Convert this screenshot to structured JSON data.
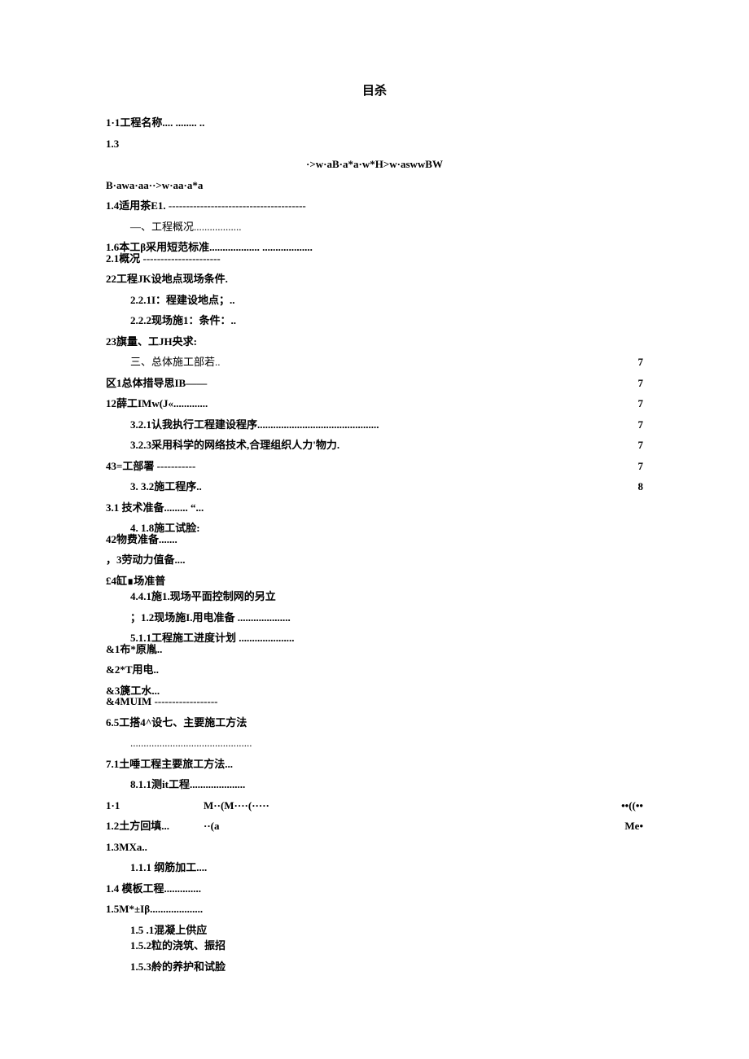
{
  "title": "目杀",
  "lines": [
    {
      "cls": "toc-line bold",
      "label": "1·1工程名称.... ........ ..",
      "page": ""
    },
    {
      "cls": "toc-line bold",
      "label": "1.3",
      "page": ""
    },
    {
      "cls": "garble center-garble",
      "label": "·>w·aB·a*a·w*H>w·aswwBW"
    },
    {
      "cls": "garble",
      "label": "B·awa·aa··>w·aa·a*a"
    },
    {
      "cls": "toc-line bold",
      "label": "1.4适用茶E1. ---------------------------------------",
      "page": ""
    },
    {
      "cls": "toc-line indent1",
      "label": "—、工程概况..................",
      "page": ""
    },
    {
      "cls": "toc-line bold",
      "label": "1.6本工β采用短范标准................... ...................",
      "page": ""
    },
    {
      "cls": "toc-line bold",
      "label": "2.1概况 ----------------------",
      "page": "",
      "style": "margin-top:-12px;"
    },
    {
      "cls": "toc-line bold",
      "label": "22工程JK设地点现场条件.",
      "page": ""
    },
    {
      "cls": "toc-line indent1 bold",
      "label": "2.2.1I：程建设地点；..",
      "page": ""
    },
    {
      "cls": "toc-line indent1 bold",
      "label": "2.2.2现场施1：条件：..",
      "page": ""
    },
    {
      "cls": "toc-line bold",
      "label": "23旗量、工JH央求:",
      "page": ""
    },
    {
      "cls": "toc-line indent1",
      "label": "三、总体施工部若..",
      "page": "7"
    },
    {
      "cls": "toc-line bold",
      "label": "区1总体措导思IB——",
      "page": "7"
    },
    {
      "cls": "toc-line bold",
      "label": "12薛工IMw(J«.............",
      "page": "7"
    },
    {
      "cls": "toc-line indent1 bold",
      "label": "3.2.1认我执行工程建设程序..............................................",
      "page": "7"
    },
    {
      "cls": "toc-line indent1 bold",
      "label": "3.2.3采用科学的网络技术,合理组织人力'物力.",
      "page": "7"
    },
    {
      "cls": "toc-line bold",
      "label": "43=工部署 -----------",
      "page": "7"
    },
    {
      "cls": "toc-line indent1 bold",
      "label": "3. 3.2施工程序..",
      "page": "8"
    },
    {
      "cls": "toc-line bold",
      "label": "3.1 技术准备......... “...",
      "page": ""
    },
    {
      "cls": "toc-line indent1 bold",
      "label": "4. 1.8施工试脸:",
      "page": ""
    },
    {
      "cls": "toc-line bold",
      "label": "42物费准备.......",
      "page": "",
      "style": "margin-top:-12px;"
    },
    {
      "cls": "toc-line bold",
      "label": "，3劳动力值备....",
      "page": ""
    },
    {
      "cls": "toc-line bold",
      "label": "£4缸∎场准普",
      "page": ""
    },
    {
      "cls": "toc-line indent1 bold",
      "label": "4.4.1施1.现场平面控制网的另立",
      "page": "",
      "style": "margin-top:-6px;"
    },
    {
      "cls": "toc-line indent1 bold",
      "label": "；1.2现场施I.用电准备 ....................",
      "page": ""
    },
    {
      "cls": "toc-line indent1 bold",
      "label": "5.1.1工程施工进度计划 .....................",
      "page": ""
    },
    {
      "cls": "toc-line bold",
      "label": "&1布*原胤..",
      "page": "",
      "style": "margin-top:-12px;"
    },
    {
      "cls": "toc-line bold",
      "label": "&2*T用电..",
      "page": ""
    },
    {
      "cls": "toc-line bold",
      "label": "&3篪工水...",
      "page": ""
    },
    {
      "cls": "toc-line bold",
      "label": "&4MUIM ------------------",
      "page": "",
      "style": "margin-top:-12px;"
    },
    {
      "cls": "toc-line bold",
      "label": "6.5工搭4^设七、主要施工方法",
      "page": ""
    },
    {
      "cls": "toc-line indent1",
      "label": "..............................................",
      "page": ""
    },
    {
      "cls": "toc-line bold",
      "label": "7.1土唾工程主要旅工方法...",
      "page": ""
    },
    {
      "cls": "toc-line indent1 bold",
      "label": "8.1.1测it工程.....................",
      "page": ""
    }
  ],
  "split_rows": [
    {
      "left": "1·1",
      "mid": "M··(M····(·····",
      "right": "••((••"
    },
    {
      "left": "1.2土方回填...",
      "mid": "··(a",
      "right": "Me•"
    }
  ],
  "tail_lines": [
    {
      "cls": "toc-line bold",
      "label": "1.3MXa..",
      "page": ""
    },
    {
      "cls": "toc-line indent1 bold",
      "label": "1.1.1  纲筋加工....",
      "page": ""
    },
    {
      "cls": "toc-line bold",
      "label": "1.4 模板工程..............",
      "page": ""
    },
    {
      "cls": "toc-line bold",
      "label": "1.5M*±Iβ....................",
      "page": ""
    },
    {
      "cls": "toc-line indent1 bold",
      "label": "1.5 .1混凝上供应",
      "page": ""
    },
    {
      "cls": "toc-line indent1 bold",
      "label": "1.5.2粒的浇筑、振招",
      "page": "",
      "style": "margin-top:-6px;"
    },
    {
      "cls": "toc-line indent1 bold",
      "label": "1.5.3舲的养护和试脸",
      "page": ""
    }
  ]
}
